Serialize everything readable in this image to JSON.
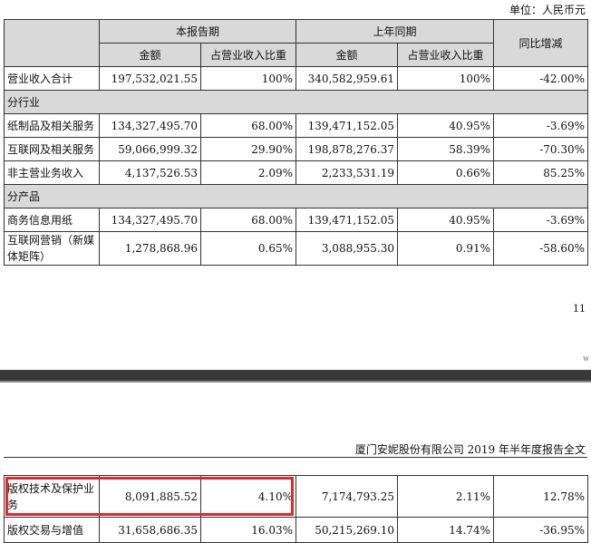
{
  "unit_label": "单位：人民币元",
  "table": {
    "group_current": "本报告期",
    "group_prior": "上年同期",
    "col_yoy": "同比增减",
    "col_amount": "金额",
    "col_ratio": "占营业收入比重",
    "total": {
      "label": "营业收入合计",
      "cur_amt": "197,532,021.55",
      "cur_ratio": "100%",
      "pri_amt": "340,582,959.61",
      "pri_ratio": "100%",
      "yoy": "-42.00%"
    },
    "section_industry": "分行业",
    "industry_rows": [
      {
        "label": "纸制品及相关服务",
        "cur_amt": "134,327,495.70",
        "cur_ratio": "68.00%",
        "pri_amt": "139,471,152.05",
        "pri_ratio": "40.95%",
        "yoy": "-3.69%"
      },
      {
        "label": "互联网及相关服务",
        "cur_amt": "59,066,999.32",
        "cur_ratio": "29.90%",
        "pri_amt": "198,878,276.37",
        "pri_ratio": "58.39%",
        "yoy": "-70.30%"
      },
      {
        "label": "非主营业务收入",
        "cur_amt": "4,137,526.53",
        "cur_ratio": "2.09%",
        "pri_amt": "2,233,531.19",
        "pri_ratio": "0.66%",
        "yoy": "85.25%"
      }
    ],
    "section_product": "分产品",
    "product_rows": [
      {
        "label": "商务信息用纸",
        "cur_amt": "134,327,495.70",
        "cur_ratio": "68.00%",
        "pri_amt": "139,471,152.05",
        "pri_ratio": "40.95%",
        "yoy": "-3.69%"
      },
      {
        "label": "互联网营销（新媒体矩阵）",
        "cur_amt": "1,278,868.96",
        "cur_ratio": "0.65%",
        "pri_amt": "3,088,955.30",
        "pri_ratio": "0.91%",
        "yoy": "-58.60%"
      }
    ]
  },
  "page_number": "11",
  "watermark": "w",
  "page2_header": "厦门安妮股份有限公司 2019 年半年度报告全文",
  "table2_rows": [
    {
      "label": "版权技术及保护业务",
      "cur_amt": "8,091,885.52",
      "cur_ratio": "4.10%",
      "pri_amt": "7,174,793.25",
      "pri_ratio": "2.11%",
      "yoy": "12.78%"
    },
    {
      "label": "版权交易与增值",
      "cur_amt": "31,658,686.35",
      "cur_ratio": "16.03%",
      "pri_amt": "50,215,269.10",
      "pri_ratio": "14.74%",
      "yoy": "-36.95%"
    }
  ]
}
